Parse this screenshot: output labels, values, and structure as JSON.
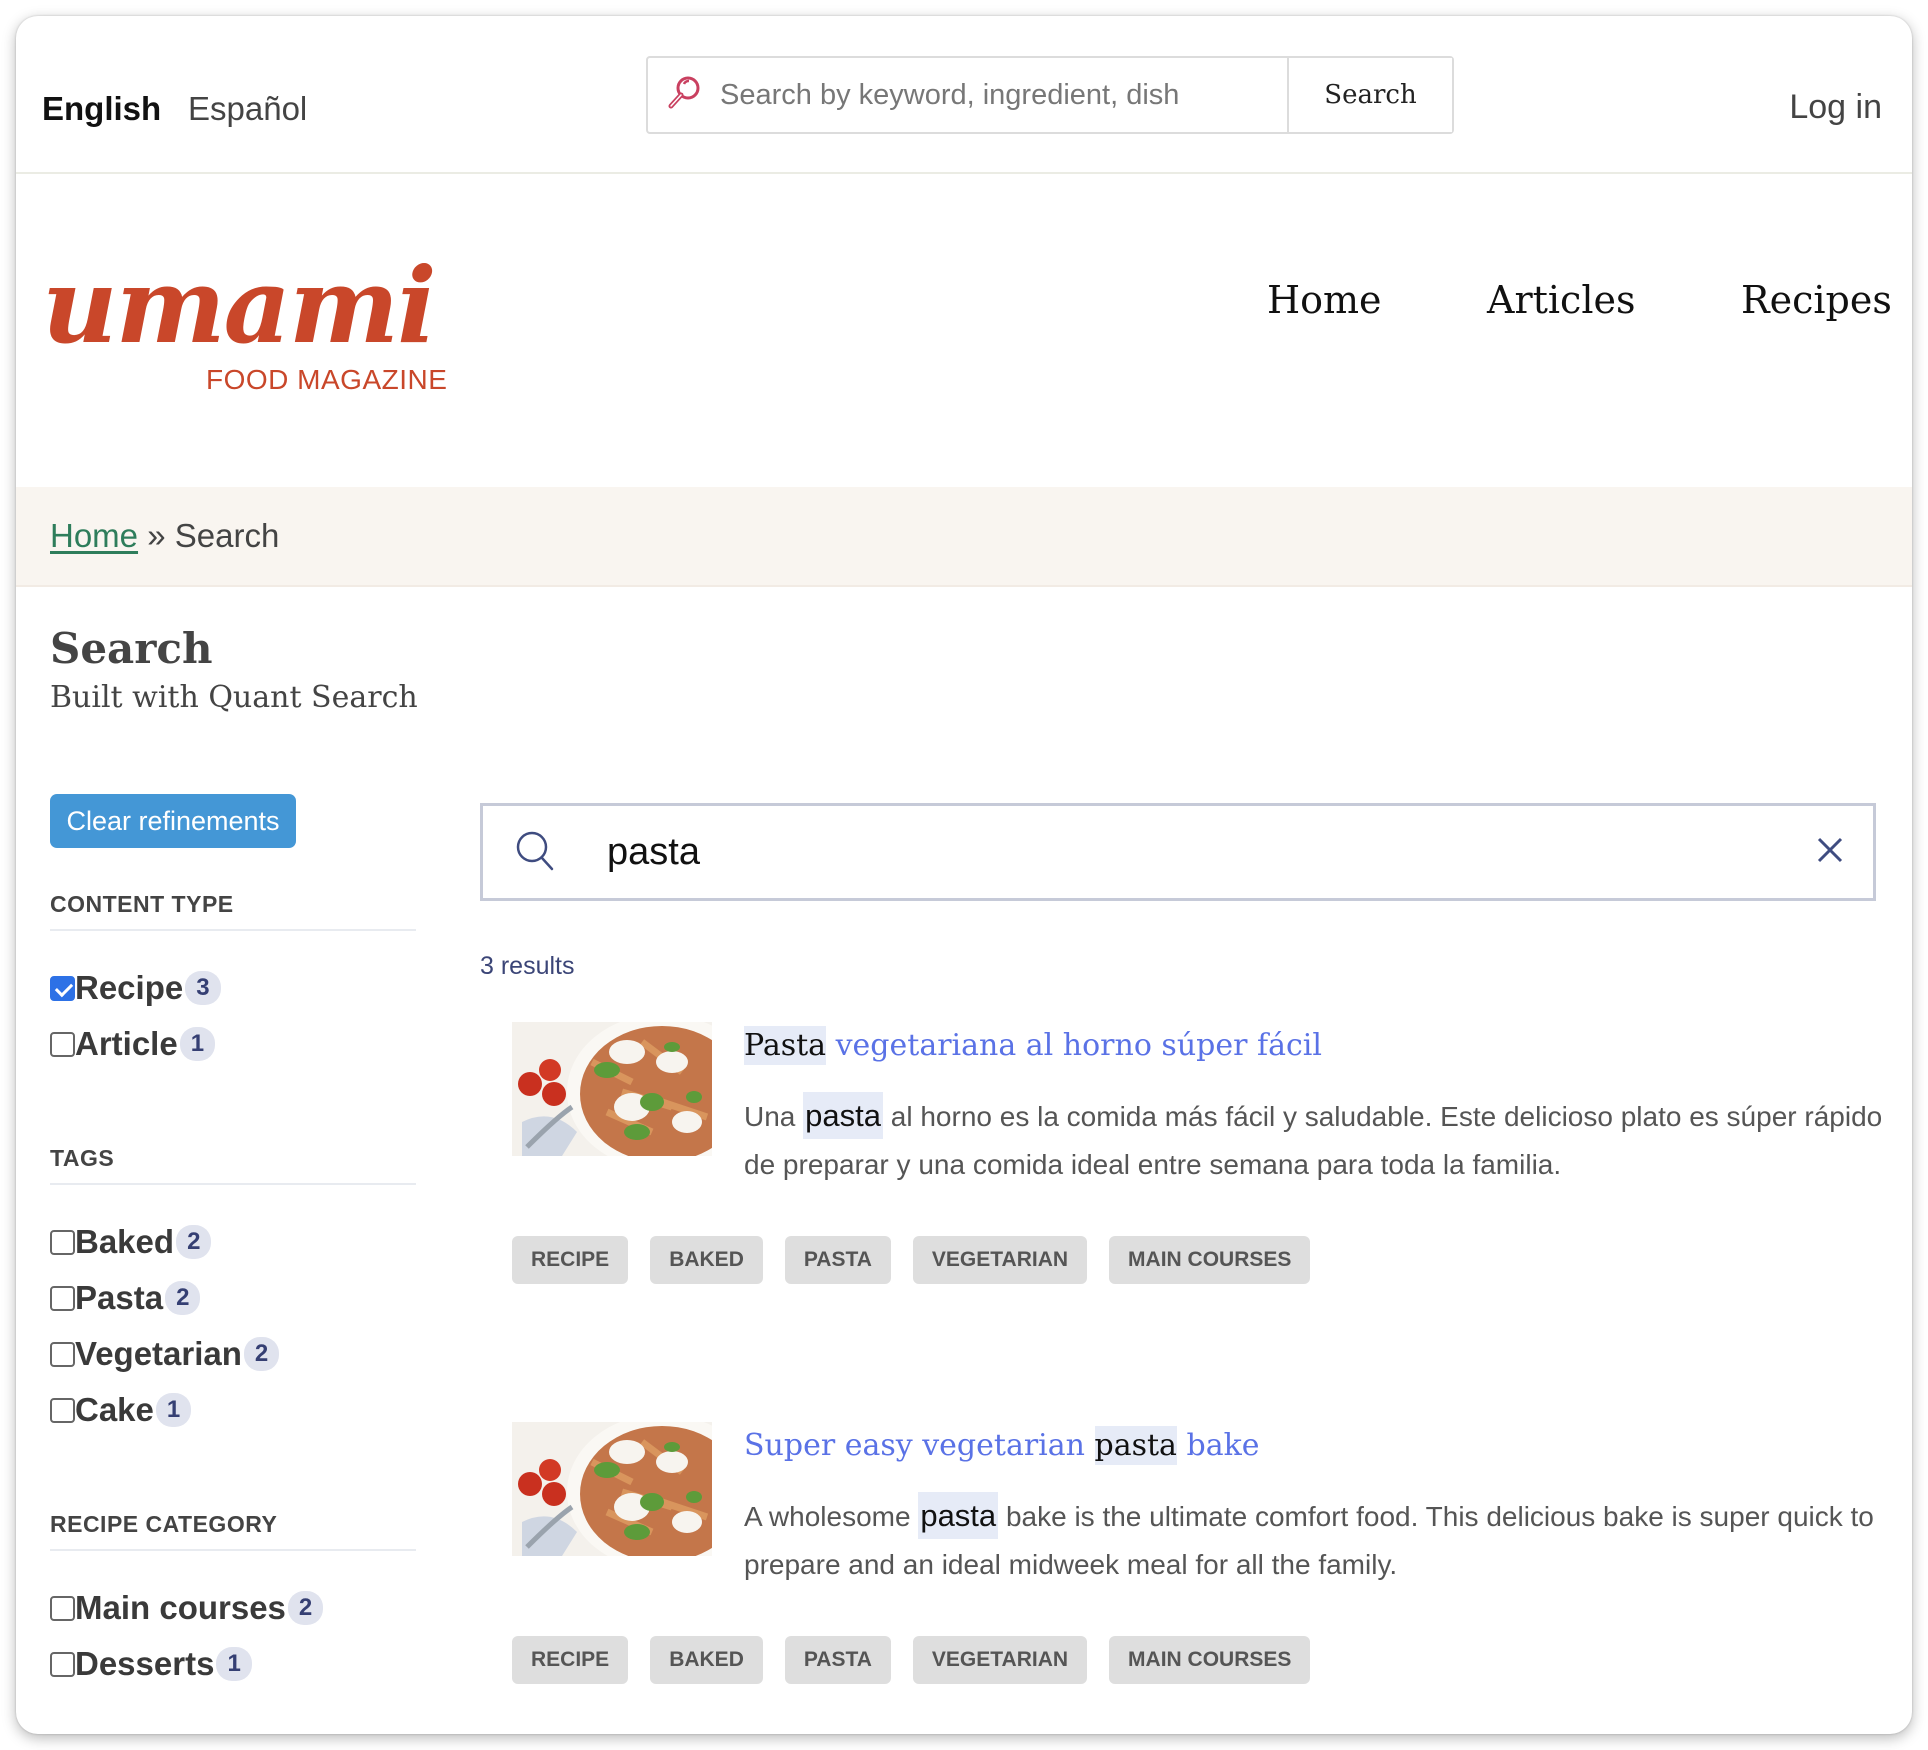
{
  "topbar": {
    "languages": [
      {
        "label": "English",
        "active": true
      },
      {
        "label": "Español",
        "active": false
      }
    ],
    "search": {
      "placeholder": "Search by keyword, ingredient, dish",
      "button_label": "Search"
    },
    "login_label": "Log in"
  },
  "header": {
    "logo": {
      "wordmark": "umami",
      "tagline": "FOOD MAGAZINE"
    },
    "nav": [
      {
        "label": "Home"
      },
      {
        "label": "Articles"
      },
      {
        "label": "Recipes"
      }
    ]
  },
  "breadcrumb": {
    "home": "Home",
    "separator": "»",
    "current": "Search"
  },
  "page": {
    "title": "Search",
    "subtitle": "Built with Quant Search"
  },
  "sidebar": {
    "clear_label": "Clear refinements",
    "facets": [
      {
        "heading": "CONTENT TYPE",
        "items": [
          {
            "label": "Recipe",
            "count": "3",
            "checked": true
          },
          {
            "label": "Article",
            "count": "1",
            "checked": false
          }
        ]
      },
      {
        "heading": "TAGS",
        "items": [
          {
            "label": "Baked",
            "count": "2",
            "checked": false
          },
          {
            "label": "Pasta",
            "count": "2",
            "checked": false
          },
          {
            "label": "Vegetarian",
            "count": "2",
            "checked": false
          },
          {
            "label": "Cake",
            "count": "1",
            "checked": false
          }
        ]
      },
      {
        "heading": "RECIPE CATEGORY",
        "items": [
          {
            "label": "Main courses",
            "count": "2",
            "checked": false
          },
          {
            "label": "Desserts",
            "count": "1",
            "checked": false
          }
        ]
      }
    ]
  },
  "search": {
    "query": "pasta",
    "result_count": "3 results"
  },
  "results": [
    {
      "title_parts": [
        {
          "text": "Pasta",
          "hl": true
        },
        {
          "text": " vegetariana al horno súper fácil",
          "hl": false
        }
      ],
      "desc_parts": [
        {
          "text": "Una ",
          "hl": false
        },
        {
          "text": "pasta",
          "hl": true
        },
        {
          "text": " al horno es la comida más fácil y saludable. Este delicioso plato es súper rápido de preparar y una comida ideal entre semana para toda la familia.",
          "hl": false
        }
      ],
      "tags": [
        "RECIPE",
        "BAKED",
        "PASTA",
        "VEGETARIAN",
        "MAIN COURSES"
      ],
      "image": "baked-pasta-photo"
    },
    {
      "title_parts": [
        {
          "text": "Super easy vegetarian ",
          "hl": false
        },
        {
          "text": "pasta",
          "hl": true
        },
        {
          "text": " bake",
          "hl": false
        }
      ],
      "desc_parts": [
        {
          "text": "A wholesome ",
          "hl": false
        },
        {
          "text": "pasta",
          "hl": true
        },
        {
          "text": " bake is the ultimate comfort food. This delicious bake is super quick to prepare and an ideal midweek meal for all the family.",
          "hl": false
        }
      ],
      "tags": [
        "RECIPE",
        "BAKED",
        "PASTA",
        "VEGETARIAN",
        "MAIN COURSES"
      ],
      "image": "baked-pasta-photo"
    }
  ],
  "colors": {
    "brand": "#c9472a",
    "link": "#5a72e6",
    "breadcrumb_link": "#2e7d5b",
    "button": "#4497d6",
    "checkbox_checked": "#2d71e6",
    "badge_bg": "#e0e3ee",
    "badge_text": "#353f73",
    "highlight": "#e6ebf7",
    "tag_bg": "#dedede",
    "breadcrumb_bg": "#f9f5f0"
  }
}
